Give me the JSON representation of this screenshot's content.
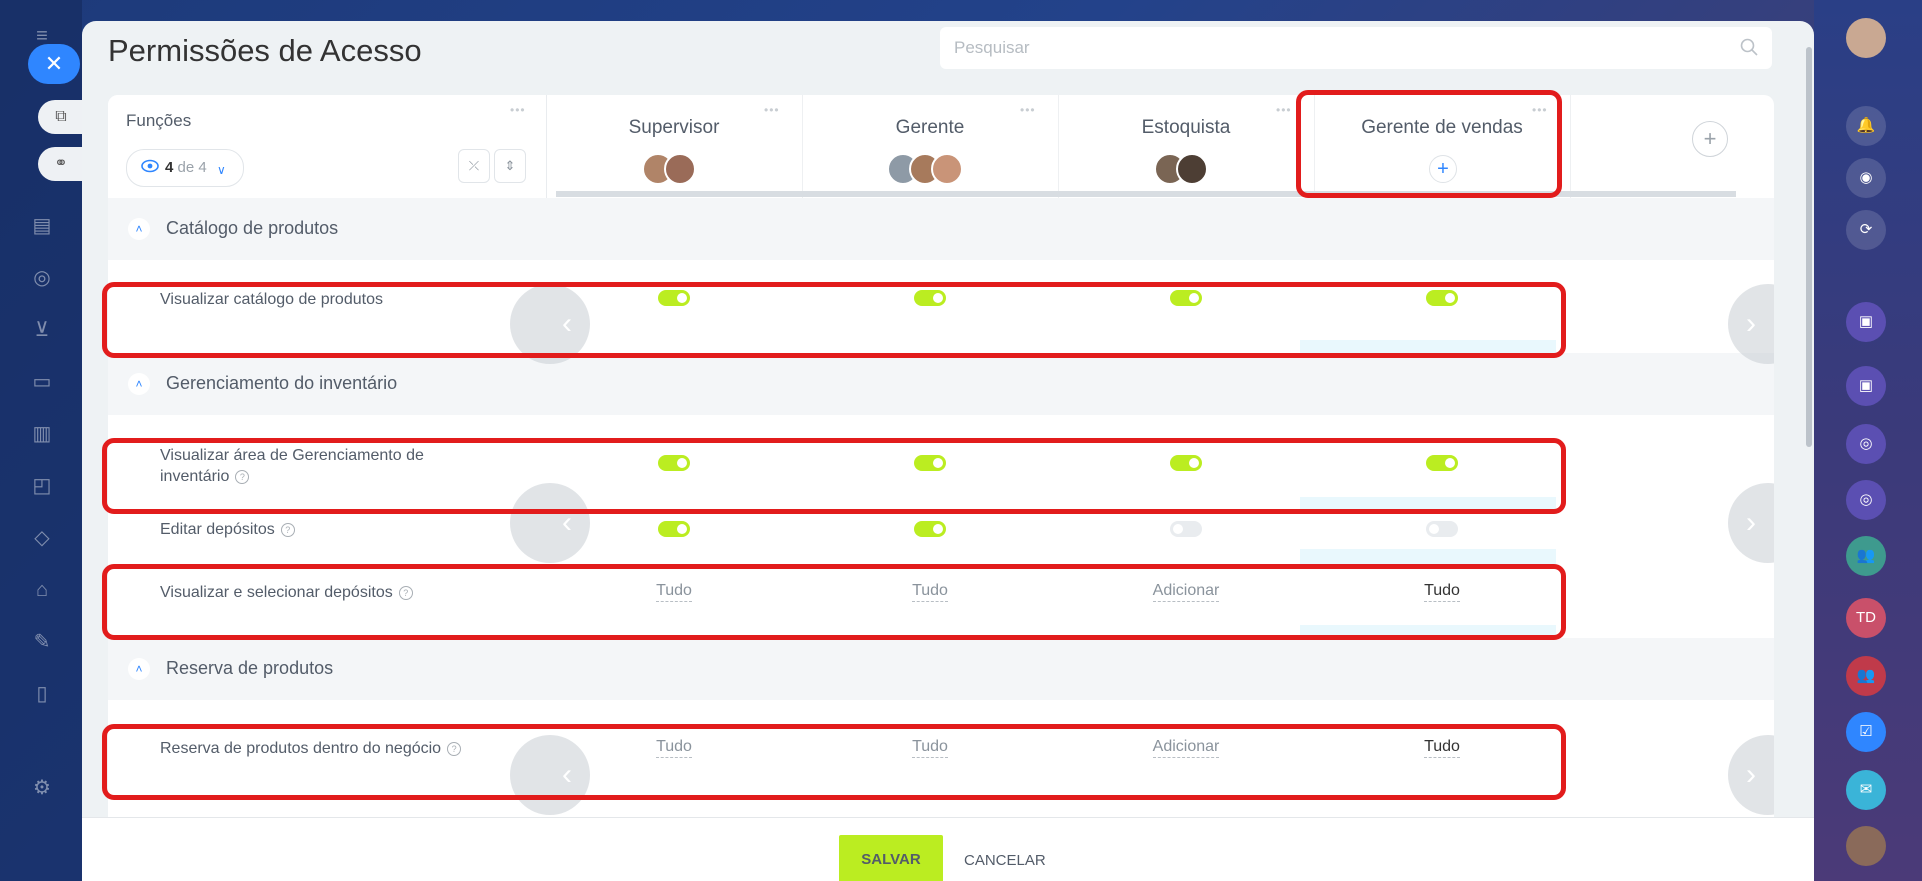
{
  "page_title": "Permissões de Acesso",
  "search": {
    "placeholder": "Pesquisar"
  },
  "header": {
    "first_col_label": "Funções",
    "visible_count": "4",
    "visible_of": "de 4"
  },
  "roles": [
    {
      "name": "Supervisor",
      "avatars": [
        "#b08468",
        "#9a6b58"
      ]
    },
    {
      "name": "Gerente",
      "avatars": [
        "#8e9aa6",
        "#a77a5c",
        "#c99478"
      ]
    },
    {
      "name": "Estoquista",
      "avatars": [
        "#7a6554",
        "#4d3e34"
      ]
    },
    {
      "name": "Gerente de vendas",
      "avatars": []
    }
  ],
  "sections": [
    {
      "title": "Catálogo de produtos",
      "rows": [
        {
          "label": "Visualizar catálogo de produtos",
          "help": false,
          "values": [
            "on",
            "on",
            "on",
            "on"
          ]
        }
      ]
    },
    {
      "title": "Gerenciamento do inventário",
      "rows": [
        {
          "label": "Visualizar área de Gerenciamento de inventário",
          "label_line1": "Visualizar área de Gerenciamento de",
          "label_line2": "inventário",
          "help": true,
          "values": [
            "on",
            "on",
            "on",
            "on"
          ]
        },
        {
          "label": "Editar depósitos",
          "help": true,
          "values": [
            "on",
            "on",
            "off",
            "off"
          ]
        },
        {
          "label": "Visualizar e selecionar depósitos",
          "help": true,
          "values": [
            "Tudo",
            "Tudo",
            "Adicionar",
            "Tudo"
          ]
        }
      ]
    },
    {
      "title": "Reserva de produtos",
      "rows": [
        {
          "label": "Reserva de produtos dentro do negócio",
          "help": true,
          "values": [
            "Tudo",
            "Tudo",
            "Adicionar",
            "Tudo"
          ]
        }
      ]
    }
  ],
  "footer": {
    "save_label": "SALVAR",
    "cancel_label": "CANCELAR"
  },
  "colors": {
    "accent": "#2f86ff",
    "toggle_on": "#bbed21",
    "highlight": "#e21c1c",
    "save_button": "#bbed21"
  },
  "right_rail": {
    "avatar_initials": "TD"
  }
}
